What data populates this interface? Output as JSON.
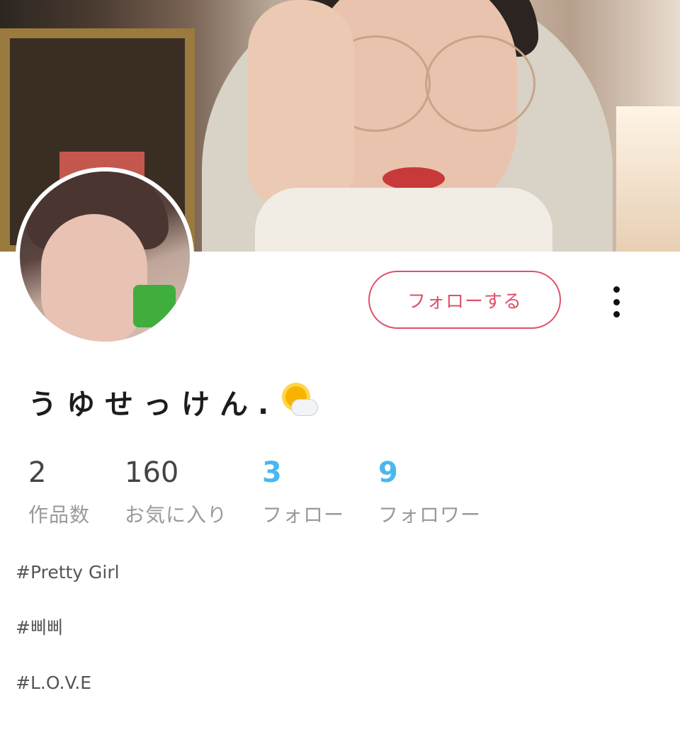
{
  "profile": {
    "name": "うゆせっけん.",
    "name_icon": "sun-behind-cloud-icon",
    "follow_label": "フォローする",
    "more_icon": "vertical-ellipsis-icon"
  },
  "stats": [
    {
      "value": "2",
      "label": "作品数"
    },
    {
      "value": "160",
      "label": "お気に入り"
    },
    {
      "value": "3",
      "label": "フォロー"
    },
    {
      "value": "9",
      "label": "フォロワー"
    }
  ],
  "tags": [
    "#Pretty Girl",
    "#삐삐",
    "#L.O.V.E"
  ],
  "colors": {
    "accent": "#e0506a",
    "link_blue": "#4ab8f0",
    "text": "#1c1c1c",
    "muted": "#9a9a9a"
  }
}
